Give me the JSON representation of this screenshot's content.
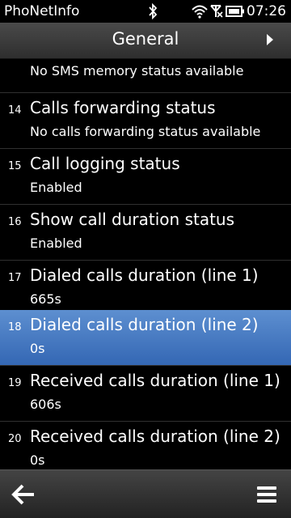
{
  "statusbar": {
    "app_name": "PhoNetInfo",
    "time": "07:26",
    "icons": [
      "bluetooth-icon",
      "wifi-icon",
      "no-signal-icon",
      "battery-icon"
    ]
  },
  "header": {
    "title": "General"
  },
  "list": {
    "partial_subtitle": "No SMS memory status available",
    "items": [
      {
        "num": "14",
        "label": "Calls forwarding status",
        "value": "No calls forwarding status available"
      },
      {
        "num": "15",
        "label": "Call logging status",
        "value": "Enabled"
      },
      {
        "num": "16",
        "label": "Show call duration status",
        "value": "Enabled"
      },
      {
        "num": "17",
        "label": "Dialed calls duration (line 1)",
        "value": "665s"
      },
      {
        "num": "18",
        "label": "Dialed calls duration (line 2)",
        "value": "0s"
      },
      {
        "num": "19",
        "label": "Received calls duration (line 1)",
        "value": "606s"
      },
      {
        "num": "20",
        "label": "Received calls duration (line 2)",
        "value": "0s"
      }
    ],
    "selected_index": 4
  },
  "toolbar": {
    "back_icon": "back-arrow-icon",
    "menu_icon": "menu-icon"
  },
  "colors": {
    "selected_top": "#5d8fd0",
    "selected_bottom": "#3467b4",
    "background": "#000000"
  }
}
